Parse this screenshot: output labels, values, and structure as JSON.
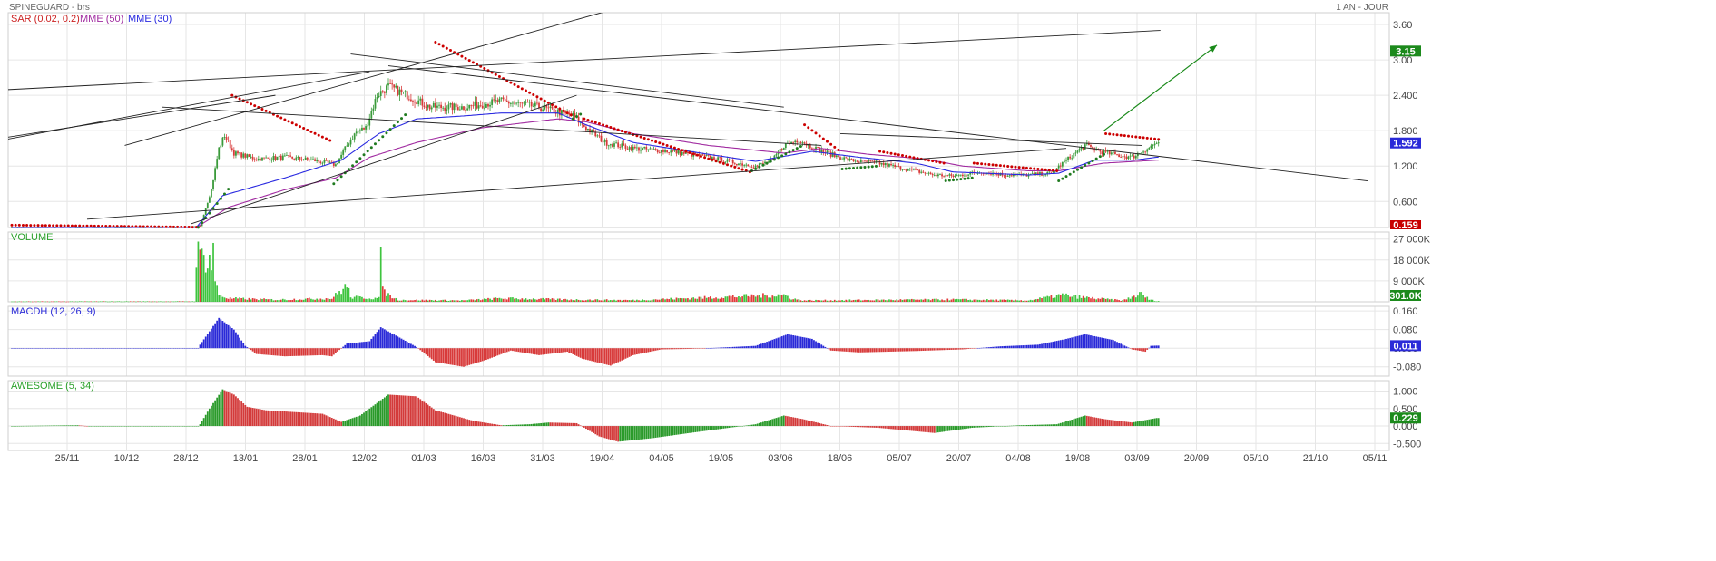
{
  "header": {
    "title": "SPINEGUARD - brs",
    "period": "1 AN - JOUR"
  },
  "colors": {
    "up": "#3a9a3a",
    "down": "#d83a3a",
    "mme50": "#a02aa0",
    "mme30": "#2a2ae0",
    "sar_up": "#1f7a1f",
    "sar_down": "#cc0000",
    "macd": "#2a2ad8",
    "grid": "#e6e6e6",
    "trend": "#222222",
    "arrow": "#1a8a1a",
    "tag_green": "#1c8a1c",
    "tag_blue": "#2a2ad8",
    "tag_red": "#c80000"
  },
  "x_axis": {
    "labels": [
      "25/11",
      "10/12",
      "28/12",
      "13/01",
      "28/01",
      "12/02",
      "01/03",
      "16/03",
      "31/03",
      "19/04",
      "04/05",
      "19/05",
      "03/06",
      "18/06",
      "05/07",
      "20/07",
      "04/08",
      "19/08",
      "03/09",
      "20/09",
      "05/10",
      "21/10",
      "05/11"
    ]
  },
  "panels": {
    "price": {
      "legend": [
        {
          "text": "SAR (0.02, 0.2)",
          "color": "#cc2222"
        },
        {
          "text": "MME (50)",
          "color": "#a02aa0"
        },
        {
          "text": "MME (30)",
          "color": "#2a2ae0"
        }
      ],
      "y_ticks": [
        "3.60",
        "3.00",
        "2.400",
        "1.800",
        "1.200",
        "0.600"
      ],
      "tags": [
        {
          "text": "3.15",
          "color": "#1c8a1c",
          "y": 3.15
        },
        {
          "text": "1.592",
          "color": "#2a2ad8",
          "y": 1.592
        },
        {
          "text": "0.159",
          "color": "#c80000",
          "y": 0.0
        }
      ]
    },
    "volume": {
      "legend": [
        {
          "text": "VOLUME",
          "color": "#2aa02a"
        }
      ],
      "y_ticks": [
        "27 000K",
        "18 000K",
        "9 000K"
      ],
      "tags": [
        {
          "text": "301.0K",
          "color": "#1c8a1c",
          "y": 0
        }
      ]
    },
    "macd": {
      "legend": [
        {
          "text": "MACDH (12, 26, 9)",
          "color": "#2a2ad8"
        }
      ],
      "y_ticks": [
        "0.160",
        "0.080",
        "0.000",
        "-0.080"
      ],
      "tags": [
        {
          "text": "0.011",
          "color": "#2a2ad8",
          "y": 0.011
        }
      ]
    },
    "awesome": {
      "legend": [
        {
          "text": "AWESOME (5, 34)",
          "color": "#2aa02a"
        }
      ],
      "y_ticks": [
        "1.000",
        "0.500",
        "0.000",
        "-0.500"
      ],
      "tags": [
        {
          "text": "0.229",
          "color": "#1c8a1c",
          "y": 0.229
        }
      ]
    }
  },
  "chart_data": {
    "type": "candlestick",
    "title": "SPINEGUARD - brs",
    "period": "1 AN - JOUR",
    "price_ylim": [
      0.159,
      3.8
    ],
    "price_knots": [
      [
        0,
        0.159
      ],
      [
        85,
        0.16
      ],
      [
        100,
        0.18
      ],
      [
        106,
        0.8
      ],
      [
        110,
        1.5
      ],
      [
        113,
        1.72
      ],
      [
        118,
        1.42
      ],
      [
        130,
        1.32
      ],
      [
        145,
        1.35
      ],
      [
        160,
        1.3
      ],
      [
        172,
        1.22
      ],
      [
        178,
        1.55
      ],
      [
        183,
        1.78
      ],
      [
        188,
        1.85
      ],
      [
        194,
        2.4
      ],
      [
        200,
        2.55
      ],
      [
        210,
        2.4
      ],
      [
        222,
        2.2
      ],
      [
        240,
        2.2
      ],
      [
        260,
        2.3
      ],
      [
        280,
        2.2
      ],
      [
        298,
        2.05
      ],
      [
        305,
        1.85
      ],
      [
        315,
        1.6
      ],
      [
        330,
        1.5
      ],
      [
        350,
        1.45
      ],
      [
        370,
        1.35
      ],
      [
        385,
        1.25
      ],
      [
        395,
        1.2
      ],
      [
        404,
        1.3
      ],
      [
        410,
        1.55
      ],
      [
        418,
        1.65
      ],
      [
        425,
        1.52
      ],
      [
        435,
        1.4
      ],
      [
        445,
        1.3
      ],
      [
        460,
        1.25
      ],
      [
        475,
        1.15
      ],
      [
        490,
        1.05
      ],
      [
        500,
        1.03
      ],
      [
        515,
        1.1
      ],
      [
        528,
        1.05
      ],
      [
        540,
        1.05
      ],
      [
        552,
        1.08
      ],
      [
        560,
        1.3
      ],
      [
        570,
        1.55
      ],
      [
        578,
        1.45
      ],
      [
        588,
        1.38
      ],
      [
        595,
        1.35
      ],
      [
        602,
        1.48
      ],
      [
        608,
        1.59
      ]
    ],
    "mme30_knots": [
      [
        0,
        0.159
      ],
      [
        98,
        0.16
      ],
      [
        112,
        0.7
      ],
      [
        145,
        1.0
      ],
      [
        175,
        1.3
      ],
      [
        195,
        1.75
      ],
      [
        215,
        2.0
      ],
      [
        240,
        2.05
      ],
      [
        260,
        2.1
      ],
      [
        290,
        2.1
      ],
      [
        305,
        1.9
      ],
      [
        330,
        1.6
      ],
      [
        370,
        1.4
      ],
      [
        395,
        1.28
      ],
      [
        425,
        1.45
      ],
      [
        450,
        1.35
      ],
      [
        480,
        1.25
      ],
      [
        500,
        1.1
      ],
      [
        540,
        1.05
      ],
      [
        556,
        1.08
      ],
      [
        575,
        1.3
      ],
      [
        596,
        1.3
      ],
      [
        608,
        1.35
      ]
    ],
    "mme50_knots": [
      [
        0,
        0.159
      ],
      [
        98,
        0.16
      ],
      [
        115,
        0.5
      ],
      [
        145,
        0.8
      ],
      [
        172,
        1.0
      ],
      [
        190,
        1.35
      ],
      [
        215,
        1.6
      ],
      [
        250,
        1.85
      ],
      [
        290,
        2.0
      ],
      [
        305,
        1.95
      ],
      [
        330,
        1.75
      ],
      [
        370,
        1.55
      ],
      [
        410,
        1.42
      ],
      [
        430,
        1.5
      ],
      [
        455,
        1.4
      ],
      [
        485,
        1.32
      ],
      [
        505,
        1.2
      ],
      [
        540,
        1.12
      ],
      [
        556,
        1.12
      ],
      [
        580,
        1.25
      ],
      [
        608,
        1.3
      ]
    ],
    "sar": [
      {
        "dir": "down",
        "start": 0,
        "end": 98,
        "from": 0.2,
        "to": 0.165
      },
      {
        "dir": "up",
        "start": 99,
        "end": 116,
        "from": 0.16,
        "to": 0.85
      },
      {
        "dir": "down",
        "start": 117,
        "end": 170,
        "from": 2.4,
        "to": 1.62
      },
      {
        "dir": "up",
        "start": 171,
        "end": 210,
        "from": 0.9,
        "to": 2.1
      },
      {
        "dir": "down",
        "start": 225,
        "end": 298,
        "from": 3.3,
        "to": 2.05
      },
      {
        "dir": "up",
        "start": 298,
        "end": 303,
        "from": 2.0,
        "to": 2.1
      },
      {
        "dir": "down",
        "start": 304,
        "end": 392,
        "from": 2.0,
        "to": 1.1
      },
      {
        "dir": "up",
        "start": 393,
        "end": 420,
        "from": 1.12,
        "to": 1.55
      },
      {
        "dir": "down",
        "start": 421,
        "end": 440,
        "from": 1.9,
        "to": 1.45
      },
      {
        "dir": "up",
        "start": 441,
        "end": 460,
        "from": 1.15,
        "to": 1.2
      },
      {
        "dir": "down",
        "start": 461,
        "end": 495,
        "from": 1.45,
        "to": 1.25
      },
      {
        "dir": "up",
        "start": 496,
        "end": 510,
        "from": 0.95,
        "to": 1.0
      },
      {
        "dir": "down",
        "start": 511,
        "end": 555,
        "from": 1.25,
        "to": 1.12
      },
      {
        "dir": "up",
        "start": 556,
        "end": 580,
        "from": 0.95,
        "to": 1.4
      },
      {
        "dir": "down",
        "start": 581,
        "end": 610,
        "from": 1.75,
        "to": 1.65
      }
    ],
    "trendlines": [
      [
        [
          -30,
          2.45
        ],
        [
          610,
          3.5
        ]
      ],
      [
        [
          -30,
          1.55
        ],
        [
          140,
          2.4
        ]
      ],
      [
        [
          60,
          1.55
        ],
        [
          330,
          3.95
        ]
      ],
      [
        [
          -20,
          1.55
        ],
        [
          190,
          2.8
        ]
      ],
      [
        [
          95,
          0.22
        ],
        [
          300,
          2.4
        ]
      ],
      [
        [
          80,
          2.2
        ],
        [
          430,
          1.55
        ]
      ],
      [
        [
          180,
          3.1
        ],
        [
          410,
          2.2
        ]
      ],
      [
        [
          200,
          2.9
        ],
        [
          720,
          0.95
        ]
      ],
      [
        [
          440,
          1.75
        ],
        [
          600,
          1.55
        ]
      ],
      [
        [
          40,
          0.3
        ],
        [
          560,
          1.5
        ]
      ]
    ],
    "arrow": {
      "from": [
        580,
        1.8
      ],
      "to": [
        640,
        3.25
      ]
    },
    "volume_ylim": [
      0,
      27000
    ],
    "volume_knots": [
      [
        0,
        150
      ],
      [
        97,
        200
      ],
      [
        98,
        21000
      ],
      [
        100,
        18500
      ],
      [
        102,
        20500
      ],
      [
        104,
        19000
      ],
      [
        106,
        16000
      ],
      [
        107,
        27000
      ],
      [
        108,
        8000
      ],
      [
        110,
        3000
      ],
      [
        115,
        1500
      ],
      [
        140,
        900
      ],
      [
        170,
        1500
      ],
      [
        178,
        7000
      ],
      [
        180,
        2000
      ],
      [
        195,
        1500
      ],
      [
        196,
        17000
      ],
      [
        198,
        4000
      ],
      [
        205,
        800
      ],
      [
        240,
        600
      ],
      [
        260,
        1500
      ],
      [
        300,
        900
      ],
      [
        330,
        700
      ],
      [
        410,
        3000
      ],
      [
        414,
        1500
      ],
      [
        420,
        600
      ],
      [
        500,
        1000
      ],
      [
        540,
        600
      ],
      [
        558,
        3000
      ],
      [
        565,
        2200
      ],
      [
        575,
        1500
      ],
      [
        590,
        600
      ],
      [
        600,
        3500
      ],
      [
        604,
        1000
      ],
      [
        608,
        301
      ]
    ],
    "macd_ylim": [
      -0.12,
      0.18
    ],
    "macd_knots": [
      [
        0,
        0
      ],
      [
        99,
        0
      ],
      [
        100,
        0.015
      ],
      [
        110,
        0.13
      ],
      [
        118,
        0.08
      ],
      [
        124,
        0.01
      ],
      [
        130,
        -0.025
      ],
      [
        145,
        -0.035
      ],
      [
        165,
        -0.03
      ],
      [
        170,
        -0.035
      ],
      [
        178,
        0.02
      ],
      [
        190,
        0.03
      ],
      [
        196,
        0.09
      ],
      [
        205,
        0.05
      ],
      [
        215,
        0.005
      ],
      [
        225,
        -0.06
      ],
      [
        240,
        -0.08
      ],
      [
        252,
        -0.05
      ],
      [
        265,
        -0.01
      ],
      [
        280,
        -0.03
      ],
      [
        295,
        -0.015
      ],
      [
        303,
        -0.045
      ],
      [
        318,
        -0.075
      ],
      [
        330,
        -0.03
      ],
      [
        345,
        -0.005
      ],
      [
        360,
        -0.003
      ],
      [
        375,
        0.002
      ],
      [
        395,
        0.01
      ],
      [
        412,
        0.06
      ],
      [
        425,
        0.04
      ],
      [
        435,
        -0.01
      ],
      [
        450,
        -0.018
      ],
      [
        480,
        -0.012
      ],
      [
        505,
        -0.005
      ],
      [
        525,
        0.008
      ],
      [
        545,
        0.015
      ],
      [
        560,
        0.04
      ],
      [
        570,
        0.06
      ],
      [
        585,
        0.035
      ],
      [
        595,
        -0.005
      ],
      [
        602,
        -0.015
      ],
      [
        605,
        0.01
      ],
      [
        608,
        0.011
      ]
    ],
    "awesome_ylim": [
      -0.7,
      1.3
    ],
    "awesome_knots": [
      [
        0,
        0
      ],
      [
        35,
        0.02
      ],
      [
        40,
        0
      ],
      [
        99,
        0
      ],
      [
        100,
        0.05
      ],
      [
        105,
        0.5
      ],
      [
        112,
        1.05
      ],
      [
        118,
        0.9
      ],
      [
        125,
        0.55
      ],
      [
        135,
        0.45
      ],
      [
        150,
        0.4
      ],
      [
        165,
        0.35
      ],
      [
        175,
        0.12
      ],
      [
        185,
        0.3
      ],
      [
        200,
        0.9
      ],
      [
        215,
        0.85
      ],
      [
        225,
        0.45
      ],
      [
        245,
        0.15
      ],
      [
        260,
        0.02
      ],
      [
        275,
        0.05
      ],
      [
        285,
        0.1
      ],
      [
        300,
        0.08
      ],
      [
        312,
        -0.3
      ],
      [
        322,
        -0.45
      ],
      [
        340,
        -0.35
      ],
      [
        360,
        -0.2
      ],
      [
        395,
        0.05
      ],
      [
        410,
        0.3
      ],
      [
        420,
        0.2
      ],
      [
        435,
        0.0
      ],
      [
        460,
        -0.05
      ],
      [
        490,
        -0.2
      ],
      [
        510,
        -0.05
      ],
      [
        535,
        0.02
      ],
      [
        555,
        0.05
      ],
      [
        570,
        0.3
      ],
      [
        580,
        0.2
      ],
      [
        595,
        0.1
      ],
      [
        608,
        0.229
      ]
    ]
  }
}
